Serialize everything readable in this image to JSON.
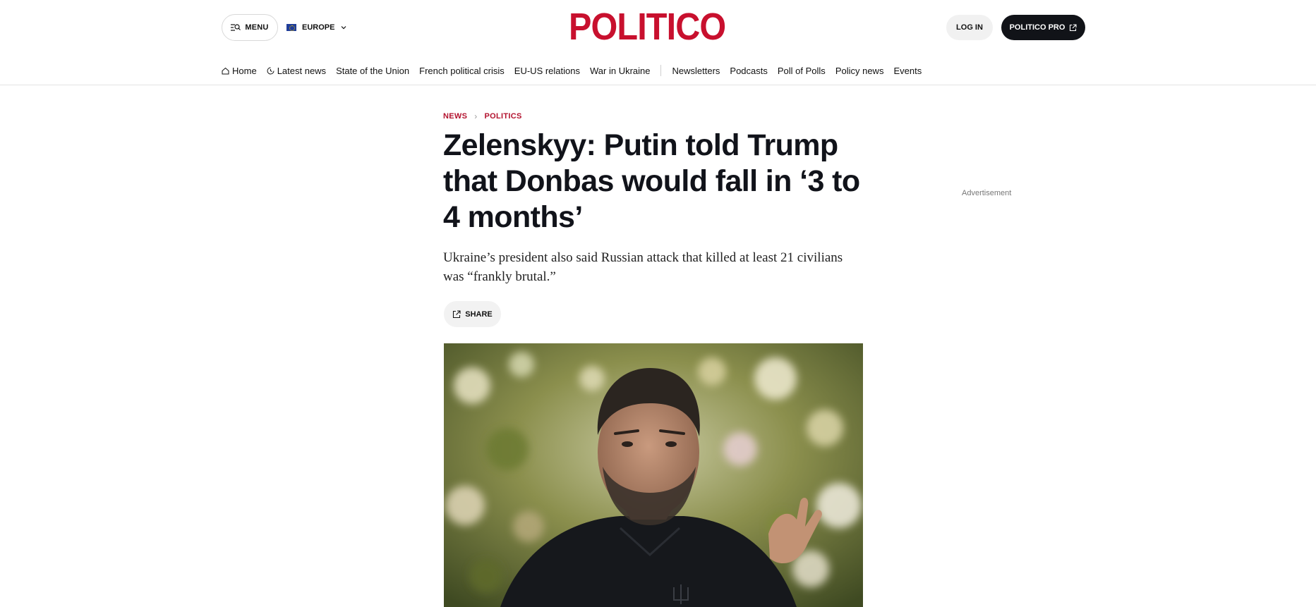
{
  "header": {
    "menu_label": "MENU",
    "edition_label": "EUROPE",
    "logo_text": "POLITICO",
    "login_label": "LOG IN",
    "pro_label": "POLITICO PRO"
  },
  "nav": {
    "items": [
      {
        "label": "Home",
        "icon": "home-icon"
      },
      {
        "label": "Latest news",
        "icon": "clock-icon"
      },
      {
        "label": "State of the Union"
      },
      {
        "label": "French political crisis"
      },
      {
        "label": "EU-US relations"
      },
      {
        "label": "War in Ukraine"
      },
      {
        "label": "Newsletters"
      },
      {
        "label": "Podcasts"
      },
      {
        "label": "Poll of Polls"
      },
      {
        "label": "Policy news"
      },
      {
        "label": "Events"
      }
    ]
  },
  "article": {
    "breadcrumb": [
      "NEWS",
      "POLITICS"
    ],
    "headline": "Zelenskyy: Putin told Trump that Donbas would fall in ‘3 to 4 months’",
    "dek": "Ukraine’s president also said Russian attack that killed at least 21 civilians was “frankly brutal.”",
    "share_label": "SHARE"
  },
  "sidebar": {
    "ad_label": "Advertisement"
  },
  "colors": {
    "brand": "#c8102e",
    "breadcrumb": "#b3122e",
    "pro_button": "#111318"
  }
}
